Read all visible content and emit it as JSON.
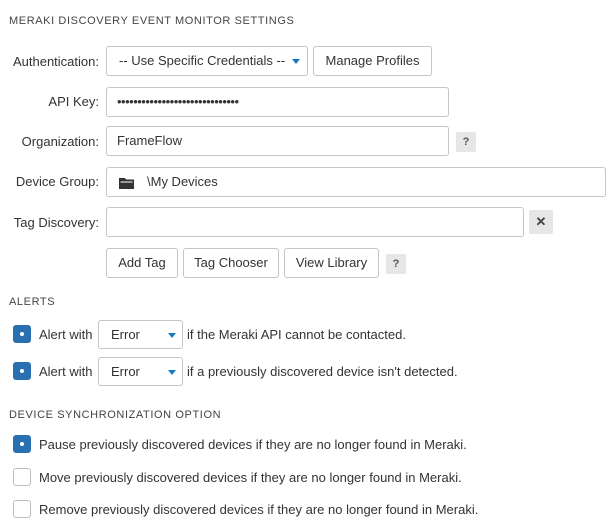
{
  "settings": {
    "title": "MERAKI DISCOVERY EVENT MONITOR SETTINGS",
    "authentication": {
      "label": "Authentication:",
      "selected": "-- Use Specific Credentials --",
      "manage_button": "Manage Profiles"
    },
    "api_key": {
      "label": "API Key:",
      "value": "••••••••••••••••••••••••••••••"
    },
    "organization": {
      "label": "Organization:",
      "value": "FrameFlow",
      "help": "?"
    },
    "device_group": {
      "label": "Device Group:",
      "value": "\\My Devices"
    },
    "tag_discovery": {
      "label": "Tag Discovery:",
      "value": "",
      "clear": "✕",
      "buttons": {
        "add_tag": "Add Tag",
        "tag_chooser": "Tag Chooser",
        "view_library": "View Library"
      },
      "help": "?"
    }
  },
  "alerts": {
    "title": "ALERTS",
    "items": [
      {
        "prefix": "Alert with",
        "level": "Error",
        "suffix": "if the Meraki API cannot be contacted.",
        "checked": true
      },
      {
        "prefix": "Alert with",
        "level": "Error",
        "suffix": "if a previously discovered device isn't detected.",
        "checked": true
      }
    ]
  },
  "sync": {
    "title": "DEVICE SYNCHRONIZATION OPTION",
    "options": [
      {
        "label": "Pause previously discovered devices if they are no longer found in Meraki.",
        "checked": true
      },
      {
        "label": "Move previously discovered devices if they are no longer found in Meraki.",
        "checked": false
      },
      {
        "label": "Remove previously discovered devices if they are no longer found in Meraki.",
        "checked": false
      }
    ]
  },
  "colors": {
    "accent": "#2a6fb0",
    "caret": "#1b78c0",
    "border": "#c5c5c5"
  }
}
